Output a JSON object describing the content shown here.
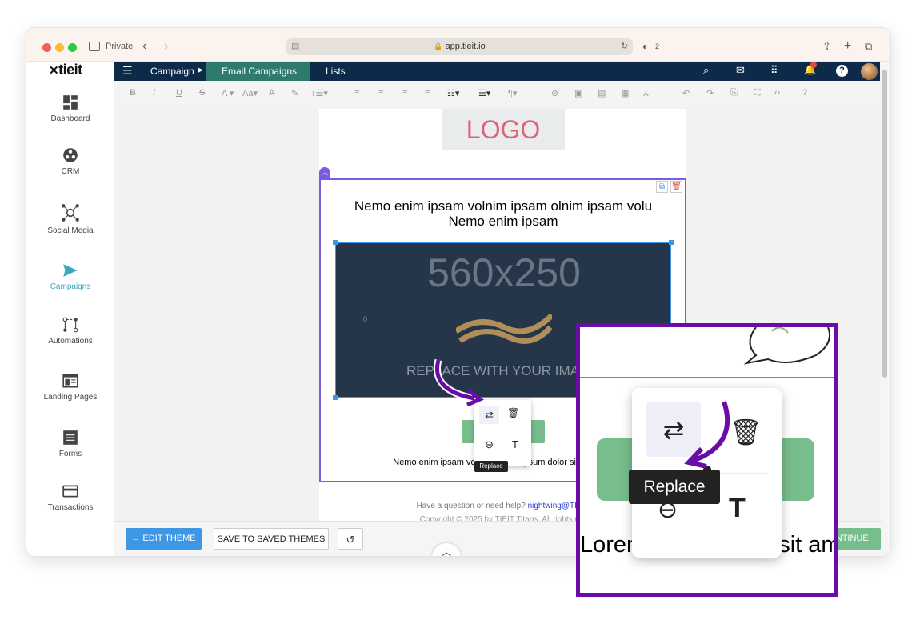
{
  "browser": {
    "private_label": "Private",
    "url": "app.tieit.io",
    "shield_count": "2"
  },
  "brand": {
    "logo_text": "tieit"
  },
  "sidebar": {
    "items": [
      {
        "label": "Dashboard",
        "icon": "dashboard-icon"
      },
      {
        "label": "CRM",
        "icon": "crm-icon"
      },
      {
        "label": "Social Media",
        "icon": "social-media-icon"
      },
      {
        "label": "Campaigns",
        "icon": "send-icon",
        "active": true
      },
      {
        "label": "Automations",
        "icon": "automations-icon"
      },
      {
        "label": "Landing Pages",
        "icon": "landing-pages-icon"
      },
      {
        "label": "Forms",
        "icon": "forms-icon"
      },
      {
        "label": "Transactions",
        "icon": "card-icon"
      }
    ]
  },
  "topnav": {
    "campaign": "Campaign",
    "email_campaigns": "Email Campaigns",
    "lists": "Lists"
  },
  "email": {
    "logo_placeholder": "LOGO",
    "headline": "Nemo enim ipsam volnim ipsam olnim ipsam volu Nemo enim ipsam",
    "image_size": "560x250",
    "image_caption": "REPLACE WITH YOUR IMAGE",
    "image_zero": "0",
    "body_text": "Nemo enim ipsam volnim Lorem ipsum dolor sit amum d",
    "footer_help": "Have a question or need help?",
    "footer_email": "nightwing@TIEIT",
    "footer_copy": "Copyright © 2025 by TIEIT Titans. All rights res"
  },
  "popup": {
    "tooltip": "Replace"
  },
  "zoom": {
    "tooltip": "Replace",
    "text_preview": "Lorem ipsum dolor sit am"
  },
  "bottom": {
    "edit_theme": "EDIT THEME",
    "save_themes": "SAVE TO SAVED THEMES",
    "continue": "CONTINUE"
  },
  "colors": {
    "nav": "#0e2a4a",
    "accent": "#39a8c0",
    "highlight": "#6a0da8",
    "green": "#78bd8c",
    "blue_btn": "#3e97e4"
  }
}
